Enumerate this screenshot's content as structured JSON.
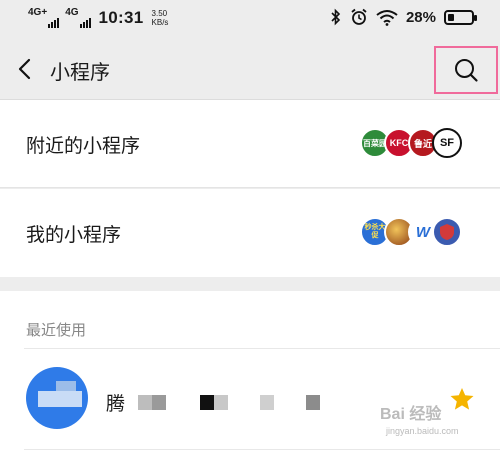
{
  "status_bar": {
    "sim1": "4G+",
    "sim2": "4G",
    "time": "10:31",
    "net_speed_value": "3.50",
    "net_speed_unit": "KB/s",
    "battery_percent": "28%",
    "battery_level": 0.28
  },
  "nav": {
    "title": "小程序",
    "back_icon": "chevron-left-icon",
    "search_icon": "search-icon"
  },
  "rows": {
    "nearby": {
      "label": "附近的小程序",
      "icons": [
        {
          "name": "baicaoyuan",
          "text": "百菜园",
          "color": "#2e8b3a"
        },
        {
          "name": "kfc",
          "text": "KFC",
          "color": "#c8102e"
        },
        {
          "name": "lujin",
          "text": "鲁近",
          "color": "#b5191f"
        },
        {
          "name": "sf-express",
          "text": "SF",
          "color": "#111111"
        }
      ]
    },
    "mine": {
      "label": "我的小程序",
      "icons": [
        {
          "name": "miaosha",
          "text": "秒杀大促",
          "color": "#2a6fd6"
        },
        {
          "name": "game",
          "text": "",
          "color": "#d9a43a"
        },
        {
          "name": "w-app",
          "text": "W",
          "color": "#ffffff"
        },
        {
          "name": "shield",
          "text": "",
          "color": "#3b5bb0"
        }
      ]
    }
  },
  "recent": {
    "title": "最近使用",
    "items": [
      {
        "name": "腾",
        "starred": true
      }
    ]
  },
  "watermark": {
    "text": "Bai 经验",
    "sub": "jingyan.baidu.com"
  },
  "colors": {
    "background": "#ededed",
    "highlight": "#f06a9b",
    "star": "#f5b400",
    "avatar": "#2f7be8"
  }
}
